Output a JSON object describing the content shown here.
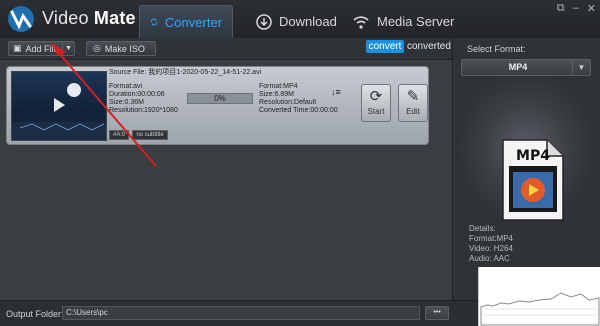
{
  "app": {
    "name_light": "Video",
    "name_bold": "Mate"
  },
  "tabs": [
    {
      "label": "Converter",
      "icon": "refresh-icon",
      "active": true
    },
    {
      "label": "Download",
      "icon": "download-icon",
      "active": false
    },
    {
      "label": "Media Server",
      "icon": "wifi-icon",
      "active": false
    }
  ],
  "window_controls": {
    "restore": "⧉",
    "minimize": "–",
    "close": "✕"
  },
  "toolbar": {
    "add_file": "Add File",
    "make_iso": "Make ISO",
    "segment_convert": "convert",
    "segment_converted": "converted"
  },
  "file_item": {
    "source_file": "Source File: 我的项目1-2020-05-22_14-51-22.avi",
    "input": {
      "format": "Format:avi",
      "duration": "Duration:00:00:06",
      "size": "Size:0.36M",
      "resolution": "Resolution:1920*1080"
    },
    "progress": 0,
    "progress_label": "0%",
    "output": {
      "format": "Format:MP4",
      "size": "Size:6.89M",
      "resolution": "Resolution:Default",
      "converted_time": "Converted Time:00:00:00"
    },
    "start_label": "Start",
    "edit_label": "Edit",
    "audio_track": "#A:0",
    "subtitle": "no subtitle"
  },
  "right_panel": {
    "select_format_label": "Select Format:",
    "selected_format": "MP4",
    "icon_text": "MP4",
    "details_title": "Details:",
    "details_format": "Format:MP4",
    "details_video": "Video: H264",
    "details_audio": "Audio: AAC"
  },
  "bottom": {
    "output_folder_label": "Output Folder:",
    "output_folder_value": "C:\\Users\\pc",
    "browse_label": "•••"
  },
  "colors": {
    "accent": "#1b8fe0",
    "active_tab_text": "#2ba8ff",
    "annotation_arrow": "#d42020"
  }
}
